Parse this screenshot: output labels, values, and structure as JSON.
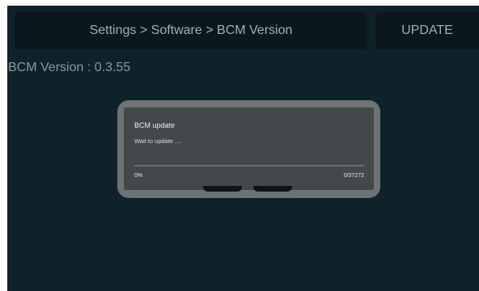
{
  "header": {
    "breadcrumb": "Settings > Software > BCM Version",
    "update_label": "UPDATE"
  },
  "main": {
    "version_text": "BCM Version : 0.3.55"
  },
  "dialog": {
    "title": "BCM update",
    "message": "Wait to update ....",
    "progress_fraction": 0,
    "progress_percent_text": "0%",
    "progress_count_text": "0/37272"
  },
  "colors": {
    "background": "#0f2229",
    "panel": "#0a171c",
    "dialog_frame": "#6f7275",
    "dialog_body": "#44484b"
  }
}
